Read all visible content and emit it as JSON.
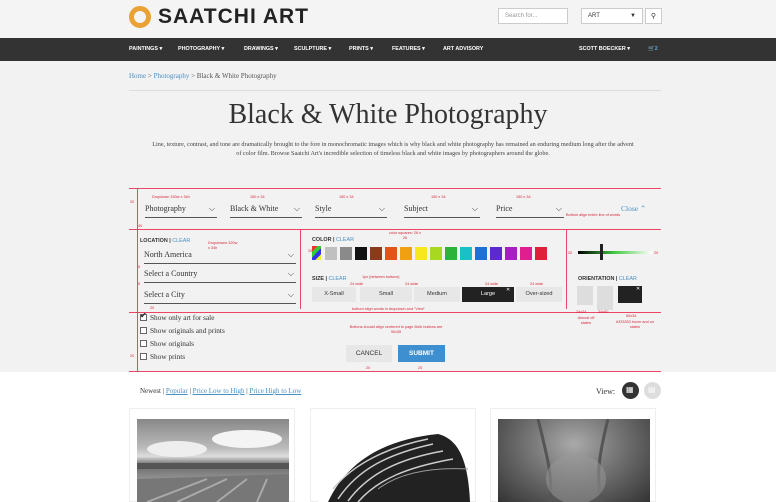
{
  "header": {
    "brand": "SAATCHI ART",
    "search_placeholder": "Search for...",
    "art_select": "ART"
  },
  "nav": {
    "items": [
      "PAINTINGS",
      "PHOTOGRAPHY",
      "DRAWINGS",
      "SCULPTURE",
      "PRINTS",
      "FEATURES",
      "ART ADVISORY"
    ],
    "user": "SCOTT BOECKER",
    "cart_count": "2"
  },
  "breadcrumb": {
    "home": "Home",
    "photography": "Photography",
    "current": "Black & White Photography",
    "sep": ">"
  },
  "page": {
    "title": "Black & White Photography",
    "intro": "Line, texture, contrast, and tone are dramatically brought to the fore in monochromatic images which is why black and white photography has remained an enduring medium long after the advent of color film. Browse Saatchi Art's incredible selection of timeless black and white images by photographers around the globe."
  },
  "filters": {
    "top": [
      "Photography",
      "Black & White",
      "Style",
      "Subject",
      "Price"
    ],
    "close": "Close",
    "location_label": "LOCATION",
    "clear": "CLEAR",
    "location_values": [
      "North America",
      "Select a Country",
      "Select a City"
    ],
    "color_label": "COLOR",
    "size_label": "SIZE",
    "sizes": [
      "X-Small",
      "Small",
      "Medium",
      "Large",
      "Over-sized"
    ],
    "selected_size": "Large",
    "orientation_label": "ORIENTATION",
    "checkboxes": [
      {
        "label": "Show only art for sale",
        "checked": true
      },
      {
        "label": "Show originals and prints",
        "checked": false
      },
      {
        "label": "Show originals",
        "checked": false
      },
      {
        "label": "Show prints",
        "checked": false
      }
    ],
    "cancel": "CANCEL",
    "submit": "SUBMIT",
    "colors": [
      "#c0c0c0",
      "#8a8a8a",
      "#111111",
      "#8a3b1a",
      "#e0561a",
      "#f0a010",
      "#f6e81c",
      "#a8d820",
      "#2bb43a",
      "#1ac0c8",
      "#1d70d8",
      "#5c2ad0",
      "#a620c0",
      "#e01e8e",
      "#e0203a"
    ]
  },
  "annotations": {
    "dropdown_size": "Dropdown 150w x 34h",
    "w150": "150 x 34",
    "dropdowns": "Dropdowns 320w x 34h",
    "color_squares": "color squares: 26 x 26",
    "gap1": "1px (between buttons)",
    "w24": "24 wide",
    "bottom_align": "Bottom align entire line of words",
    "bottom_align_dd": "bottom align words in dropdown and \"View\"",
    "buttons_centered": "Buttons should align centered to page Both buttons are 90x35",
    "orient_off": "Almost off states",
    "orient_on": "#333333 hover and on states",
    "filter_align": "Bottom align the filter text links and the word \"Views\"",
    "n20": "20",
    "n10": "10",
    "n5": "5",
    "n40": "40",
    "n18": "18",
    "s24x24": "24x24",
    "s34x24": "34x50",
    "s50x34": "50x34"
  },
  "sort": {
    "newest": "Newest",
    "popular": "Popular",
    "low_high": "Price Low to High",
    "high_low": "Price High to Low",
    "view": "View:"
  }
}
